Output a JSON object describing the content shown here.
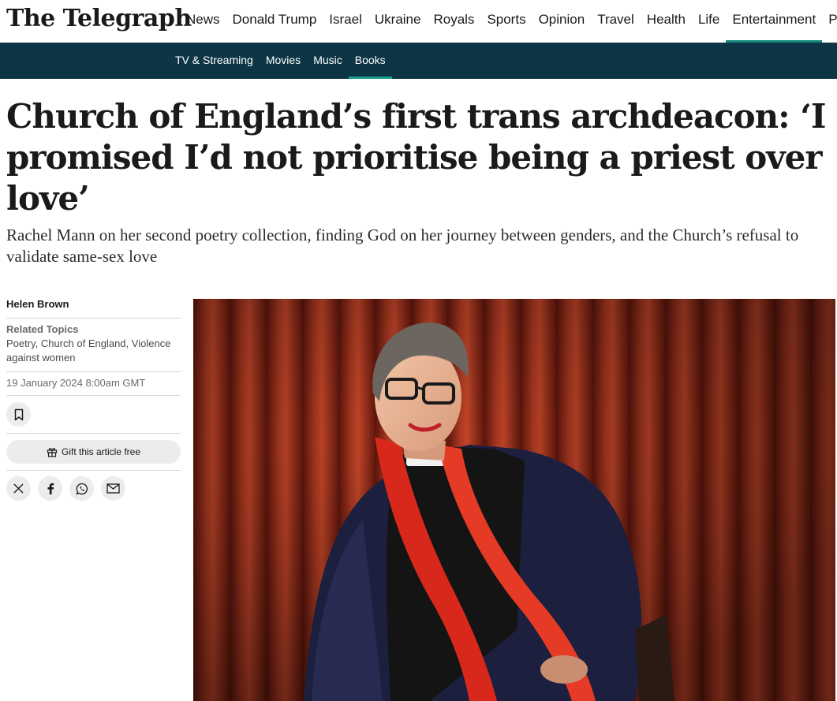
{
  "header": {
    "logo_text": "The Telegraph",
    "nav": [
      {
        "label": "News",
        "active": false
      },
      {
        "label": "Donald Trump",
        "active": false
      },
      {
        "label": "Israel",
        "active": false
      },
      {
        "label": "Ukraine",
        "active": false
      },
      {
        "label": "Royals",
        "active": false
      },
      {
        "label": "Sports",
        "active": false
      },
      {
        "label": "Opinion",
        "active": false
      },
      {
        "label": "Travel",
        "active": false
      },
      {
        "label": "Health",
        "active": false
      },
      {
        "label": "Life",
        "active": false
      },
      {
        "label": "Entertainment",
        "active": true
      },
      {
        "label": "Puzz",
        "active": false
      }
    ],
    "subnav": [
      {
        "label": "TV & Streaming",
        "active": false
      },
      {
        "label": "Movies",
        "active": false
      },
      {
        "label": "Music",
        "active": false
      },
      {
        "label": "Books",
        "active": true
      }
    ]
  },
  "article": {
    "headline": "Church of England’s first trans archdeacon: ‘I promised I’d not prioritise being a priest over love’",
    "standfirst": "Rachel Mann on her second poetry collection, finding God on her journey between genders, and the Church’s refusal to validate same-sex love",
    "author": "Helen Brown",
    "related_title": "Related Topics",
    "related_topics": [
      "Poetry",
      "Church of England",
      "Violence against women"
    ],
    "date": "19 January 2024 8:00am GMT",
    "gift_label": "Gift this article free",
    "share_icons": [
      "x-icon",
      "facebook-icon",
      "whatsapp-icon",
      "email-icon"
    ]
  },
  "colors": {
    "accent": "#138c7c",
    "subnav_bg": "#0d3545",
    "curtain": "#a8301c"
  }
}
